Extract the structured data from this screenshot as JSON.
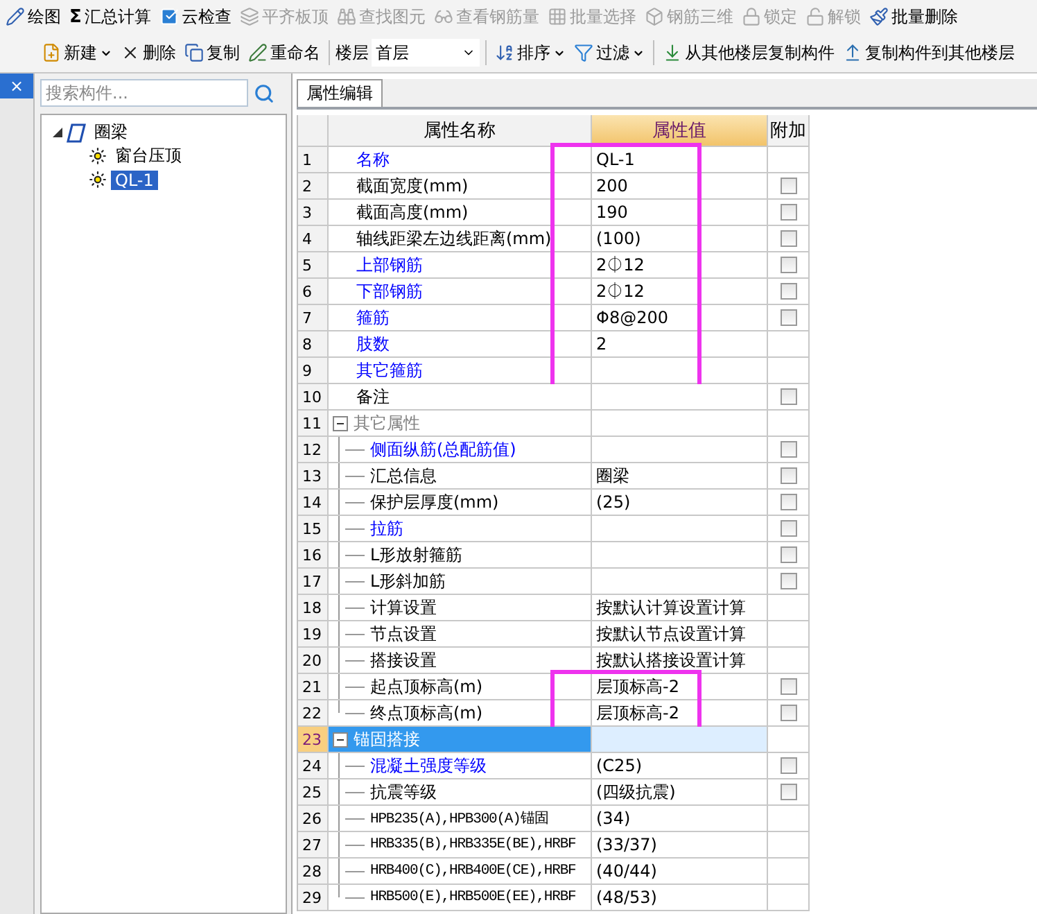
{
  "toolbar": [
    {
      "label": "绘图",
      "kind": "draw",
      "disabled": false
    },
    {
      "label": "汇总计算",
      "kind": "glyph",
      "glyph": "Σ",
      "disabled": false
    },
    {
      "label": "云检查",
      "kind": "check",
      "disabled": false
    },
    {
      "label": "平齐板顶",
      "kind": "slab",
      "disabled": true
    },
    {
      "label": "查找图元",
      "kind": "find",
      "disabled": true
    },
    {
      "label": "查看钢筋量",
      "kind": "glasses",
      "disabled": true
    },
    {
      "label": "批量选择",
      "kind": "grid",
      "disabled": true
    },
    {
      "label": "钢筋三维",
      "kind": "cube",
      "disabled": true
    },
    {
      "label": "锁定",
      "kind": "lock",
      "disabled": true
    },
    {
      "label": "解锁",
      "kind": "unlock",
      "disabled": true
    },
    {
      "label": "批量删除",
      "kind": "brush",
      "disabled": false
    }
  ],
  "component_toolbar": [
    {
      "label": "新建",
      "kind": "new",
      "dropdown": true
    },
    {
      "label": "删除",
      "kind": "delete",
      "dropdown": false
    },
    {
      "label": "复制",
      "kind": "copy",
      "dropdown": false
    },
    {
      "label": "重命名",
      "kind": "rename",
      "dropdown": false
    },
    {
      "label": "楼层",
      "kind": "floor",
      "value": "首层"
    },
    {
      "label": "排序",
      "kind": "sort",
      "dropdown": true
    },
    {
      "label": "过滤",
      "kind": "filter",
      "dropdown": true
    },
    {
      "label": "从其他楼层复制构件",
      "kind": "copy-in",
      "dropdown": false
    },
    {
      "label": "复制构件到其他楼层",
      "kind": "copy-out",
      "dropdown": false
    }
  ],
  "side_close": "×",
  "search": {
    "placeholder": "搜索构件..."
  },
  "tree": [
    {
      "label": "圈梁",
      "kind": "category",
      "expanded": true,
      "selected": false,
      "children": [
        {
          "label": "窗台压顶",
          "kind": "item",
          "selected": false
        },
        {
          "label": "QL-1",
          "kind": "item",
          "selected": true
        }
      ]
    }
  ],
  "tabs": [
    {
      "label": "属性编辑",
      "selected": true
    }
  ],
  "table": {
    "columns": [
      "属性名称",
      "属性值",
      "附加"
    ],
    "rows": [
      {
        "num": "1",
        "name": "名称",
        "kind": "link",
        "value": "QL-1",
        "selected": false,
        "marked": true
      },
      {
        "num": "2",
        "name": "截面宽度(mm)",
        "kind": "plain",
        "value": "200",
        "checked": false,
        "selected": false,
        "marked": true
      },
      {
        "num": "3",
        "name": "截面高度(mm)",
        "kind": "plain",
        "value": "190",
        "checked": false,
        "selected": false,
        "marked": true
      },
      {
        "num": "4",
        "name": "轴线距梁左边线距离(mm)",
        "kind": "plain",
        "value": "(100)",
        "checked": false,
        "selected": false,
        "marked": true
      },
      {
        "num": "5",
        "name": "上部钢筋",
        "kind": "link",
        "value": "2⏀12",
        "checked": false,
        "selected": false,
        "marked": true
      },
      {
        "num": "6",
        "name": "下部钢筋",
        "kind": "link",
        "value": "2⏀12",
        "checked": false,
        "selected": false,
        "marked": true
      },
      {
        "num": "7",
        "name": "箍筋",
        "kind": "link",
        "value": "Φ8@200",
        "checked": false,
        "selected": false,
        "marked": true
      },
      {
        "num": "8",
        "name": "肢数",
        "kind": "link",
        "value": "2",
        "selected": false,
        "marked": true
      },
      {
        "num": "9",
        "name": "其它箍筋",
        "kind": "link",
        "selected": false,
        "marked": true
      },
      {
        "num": "10",
        "name": "备注",
        "kind": "plain",
        "checked": false,
        "selected": false,
        "marked": false
      },
      {
        "num": "11",
        "name": "其它属性",
        "kind": "group",
        "expanded": true,
        "selected": false,
        "marked": false,
        "children": [
          {
            "num": "12",
            "name": "侧面纵筋(总配筋值)",
            "kind": "link",
            "checked": false,
            "selected": false,
            "marked": false
          },
          {
            "num": "13",
            "name": "汇总信息",
            "kind": "plain",
            "value": "圈梁",
            "checked": false,
            "selected": false,
            "marked": false
          },
          {
            "num": "14",
            "name": "保护层厚度(mm)",
            "kind": "plain",
            "value": "(25)",
            "checked": false,
            "selected": false,
            "marked": false
          },
          {
            "num": "15",
            "name": "拉筋",
            "kind": "link",
            "checked": false,
            "selected": false,
            "marked": false
          },
          {
            "num": "16",
            "name": "L形放射箍筋",
            "kind": "plain",
            "checked": false,
            "selected": false,
            "marked": false
          },
          {
            "num": "17",
            "name": "L形斜加筋",
            "kind": "plain",
            "checked": false,
            "selected": false,
            "marked": false
          },
          {
            "num": "18",
            "name": "计算设置",
            "kind": "plain",
            "value": "按默认计算设置计算",
            "selected": false,
            "marked": false
          },
          {
            "num": "19",
            "name": "节点设置",
            "kind": "plain",
            "value": "按默认节点设置计算",
            "selected": false,
            "marked": false
          },
          {
            "num": "20",
            "name": "搭接设置",
            "kind": "plain",
            "value": "按默认搭接设置计算",
            "selected": false,
            "marked": false
          },
          {
            "num": "21",
            "name": "起点顶标高(m)",
            "kind": "plain",
            "value": "层顶标高-2",
            "checked": false,
            "selected": false,
            "marked": true
          },
          {
            "num": "22",
            "name": "终点顶标高(m)",
            "kind": "plain",
            "value": "层顶标高-2",
            "checked": false,
            "selected": false,
            "marked": true
          }
        ]
      },
      {
        "num": "23",
        "name": "锚固搭接",
        "kind": "group",
        "expanded": true,
        "selected": true,
        "marked": false,
        "children": [
          {
            "num": "24",
            "name": "混凝土强度等级",
            "kind": "link",
            "value": "(C25)",
            "checked": false,
            "selected": false,
            "marked": false
          },
          {
            "num": "25",
            "name": "抗震等级",
            "kind": "plain",
            "value": "(四级抗震)",
            "checked": false,
            "selected": false,
            "marked": false
          },
          {
            "num": "26",
            "name": "HPB235(A),HPB300(A)锚固",
            "kind": "plain",
            "value": "(34)",
            "selected": false,
            "marked": false
          },
          {
            "num": "27",
            "name": "HRB335(B),HRB335E(BE),HRBF",
            "kind": "plain",
            "value": "(33/37)",
            "selected": false,
            "marked": false
          },
          {
            "num": "28",
            "name": "HRB400(C),HRB400E(CE),HRBF",
            "kind": "plain",
            "value": "(40/44)",
            "selected": false,
            "marked": false
          },
          {
            "num": "29",
            "name": "HRB500(E),HRB500E(EE),HRBF",
            "kind": "plain",
            "value": "(48/53)",
            "selected": false,
            "marked": false
          }
        ]
      }
    ]
  }
}
